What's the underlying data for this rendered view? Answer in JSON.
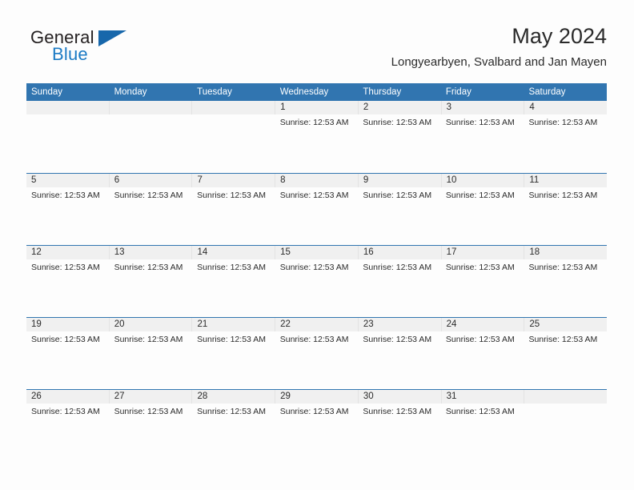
{
  "brand": {
    "name_part1": "General",
    "name_part2": "Blue",
    "triangle_icon": "triangle-icon",
    "color_dark": "#231f20",
    "color_blue": "#1b7ac4"
  },
  "header": {
    "title": "May 2024",
    "subtitle": "Longyearbyen, Svalbard and Jan Mayen"
  },
  "theme": {
    "header_blue": "#3175b0",
    "number_band_gray": "#f0f0f0",
    "page_background": "#fdfdfd",
    "text_color": "#2b2b2b"
  },
  "calendar": {
    "day_headers": [
      "Sunday",
      "Monday",
      "Tuesday",
      "Wednesday",
      "Thursday",
      "Friday",
      "Saturday"
    ],
    "weeks": [
      {
        "numbers": [
          "",
          "",
          "",
          "1",
          "2",
          "3",
          "4"
        ],
        "events": [
          "",
          "",
          "",
          "Sunrise: 12:53 AM",
          "Sunrise: 12:53 AM",
          "Sunrise: 12:53 AM",
          "Sunrise: 12:53 AM"
        ]
      },
      {
        "numbers": [
          "5",
          "6",
          "7",
          "8",
          "9",
          "10",
          "11"
        ],
        "events": [
          "Sunrise: 12:53 AM",
          "Sunrise: 12:53 AM",
          "Sunrise: 12:53 AM",
          "Sunrise: 12:53 AM",
          "Sunrise: 12:53 AM",
          "Sunrise: 12:53 AM",
          "Sunrise: 12:53 AM"
        ]
      },
      {
        "numbers": [
          "12",
          "13",
          "14",
          "15",
          "16",
          "17",
          "18"
        ],
        "events": [
          "Sunrise: 12:53 AM",
          "Sunrise: 12:53 AM",
          "Sunrise: 12:53 AM",
          "Sunrise: 12:53 AM",
          "Sunrise: 12:53 AM",
          "Sunrise: 12:53 AM",
          "Sunrise: 12:53 AM"
        ]
      },
      {
        "numbers": [
          "19",
          "20",
          "21",
          "22",
          "23",
          "24",
          "25"
        ],
        "events": [
          "Sunrise: 12:53 AM",
          "Sunrise: 12:53 AM",
          "Sunrise: 12:53 AM",
          "Sunrise: 12:53 AM",
          "Sunrise: 12:53 AM",
          "Sunrise: 12:53 AM",
          "Sunrise: 12:53 AM"
        ]
      },
      {
        "numbers": [
          "26",
          "27",
          "28",
          "29",
          "30",
          "31",
          ""
        ],
        "events": [
          "Sunrise: 12:53 AM",
          "Sunrise: 12:53 AM",
          "Sunrise: 12:53 AM",
          "Sunrise: 12:53 AM",
          "Sunrise: 12:53 AM",
          "Sunrise: 12:53 AM",
          ""
        ]
      }
    ]
  }
}
